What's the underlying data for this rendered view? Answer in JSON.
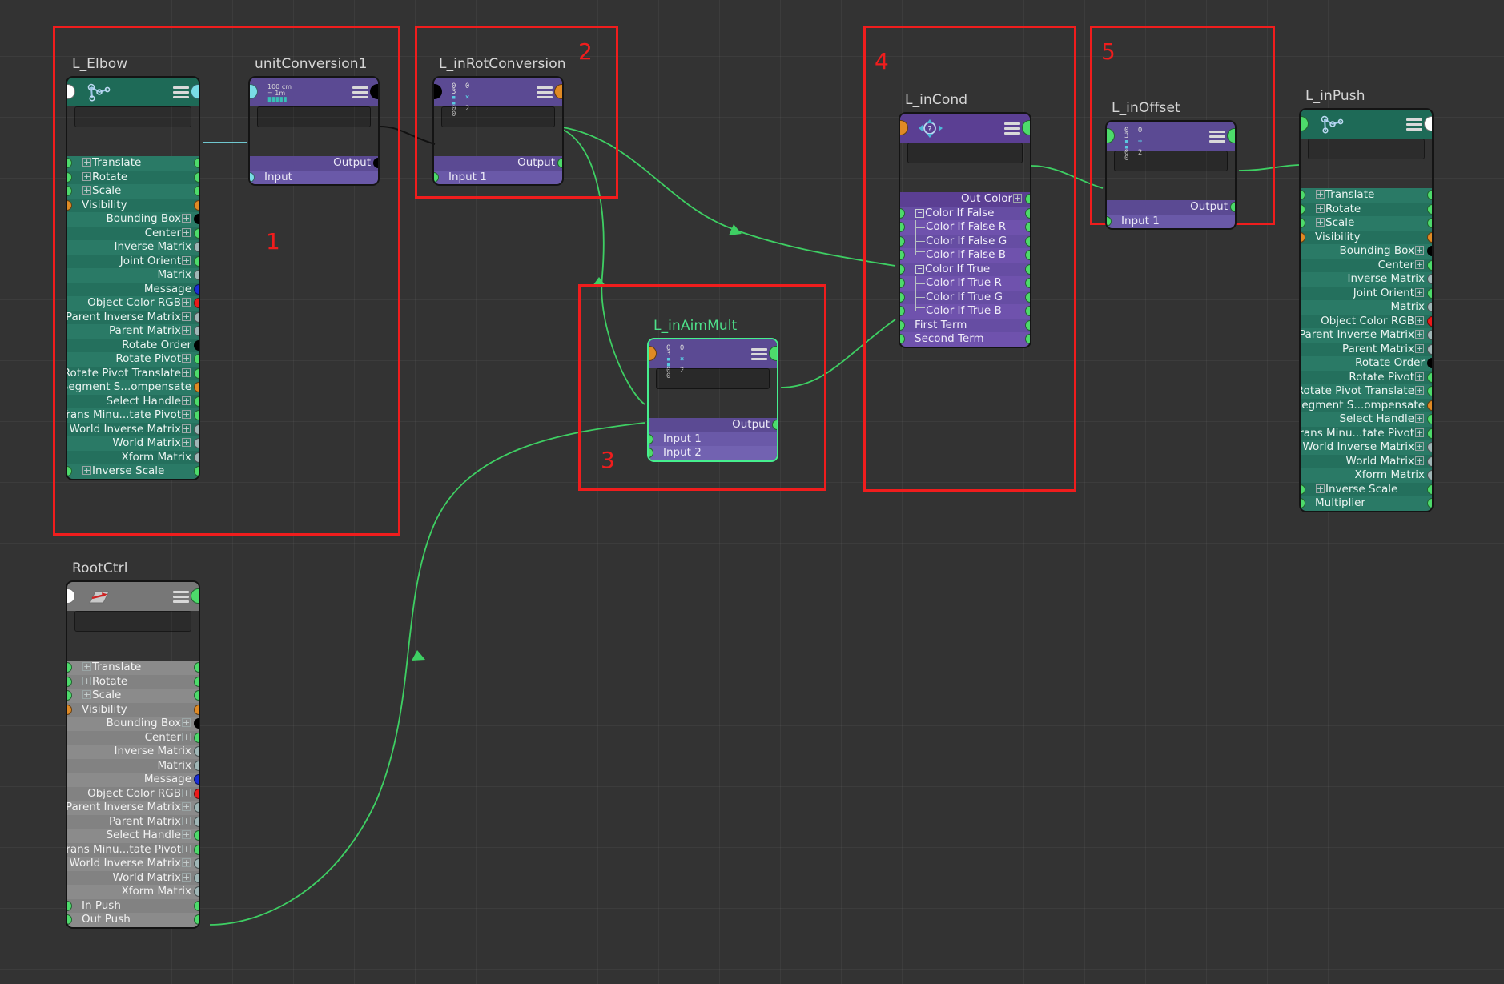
{
  "app": {
    "editor": "Maya Node Editor"
  },
  "annotations": [
    {
      "id": "1",
      "label": "1"
    },
    {
      "id": "2",
      "label": "2"
    },
    {
      "id": "3",
      "label": "3"
    },
    {
      "id": "4",
      "label": "4"
    },
    {
      "id": "5",
      "label": "5"
    }
  ],
  "colors": {
    "joint_header": "#1e6a57",
    "joint_row": "#2a7a66",
    "util_header": "#5b4a93",
    "util_row": "#7262b1",
    "xform_header": "#777777",
    "xform_row": "#8b8b8b",
    "annotation_red": "#f01d1d",
    "wire_green": "#3ecf63",
    "wire_cyan": "#79dde6",
    "selection_green": "#46ef8e",
    "canvas_bg": "#333333"
  },
  "nodes": {
    "l_elbow": {
      "title": "L_Elbow",
      "type": "joint",
      "icon": "joint-icon",
      "menu_icon": "hamburger-icon",
      "rows": [
        {
          "label": "Translate",
          "side": "in",
          "expand": "plus",
          "in": "green",
          "out": "green"
        },
        {
          "label": "Rotate",
          "side": "in",
          "expand": "plus",
          "in": "green",
          "out": "green"
        },
        {
          "label": "Scale",
          "side": "in",
          "expand": "plus",
          "in": "green",
          "out": "green"
        },
        {
          "label": "Visibility",
          "side": "in",
          "expand": "none",
          "in": "orange",
          "out": "orange"
        },
        {
          "label": "Bounding Box",
          "side": "out",
          "expand": "plus",
          "out": "black"
        },
        {
          "label": "Center",
          "side": "out",
          "expand": "plus",
          "out": "green"
        },
        {
          "label": "Inverse Matrix",
          "side": "out",
          "expand": "none",
          "out": "grey"
        },
        {
          "label": "Joint Orient",
          "side": "out",
          "expand": "plus",
          "out": "green"
        },
        {
          "label": "Matrix",
          "side": "out",
          "expand": "none",
          "out": "grey"
        },
        {
          "label": "Message",
          "side": "out",
          "expand": "none",
          "out": "blue"
        },
        {
          "label": "Object Color RGB",
          "side": "out",
          "expand": "plus",
          "out": "red"
        },
        {
          "label": "Parent Inverse Matrix",
          "side": "out",
          "expand": "plus",
          "out": "grey"
        },
        {
          "label": "Parent Matrix",
          "side": "out",
          "expand": "plus",
          "out": "grey"
        },
        {
          "label": "Rotate Order",
          "side": "out",
          "expand": "none",
          "out": "black"
        },
        {
          "label": "Rotate Pivot",
          "side": "out",
          "expand": "plus",
          "out": "green"
        },
        {
          "label": "Rotate Pivot Translate",
          "side": "out",
          "expand": "plus",
          "out": "green"
        },
        {
          "label": "Segment S...ompensate",
          "side": "out",
          "expand": "none",
          "out": "orange"
        },
        {
          "label": "Select Handle",
          "side": "out",
          "expand": "plus",
          "out": "green"
        },
        {
          "label": "Trans Minu...tate Pivot",
          "side": "out",
          "expand": "plus",
          "out": "green"
        },
        {
          "label": "World Inverse Matrix",
          "side": "out",
          "expand": "plus",
          "out": "grey"
        },
        {
          "label": "World Matrix",
          "side": "out",
          "expand": "plus",
          "out": "grey"
        },
        {
          "label": "Xform Matrix",
          "side": "out",
          "expand": "none",
          "out": "grey"
        },
        {
          "label": "Inverse Scale",
          "side": "in",
          "expand": "plus",
          "in": "green",
          "out": "green"
        }
      ],
      "header_in": "white",
      "header_out": "cyan"
    },
    "rootctrl": {
      "title": "RootCtrl",
      "type": "xform",
      "icon": "transform-arrow-icon",
      "menu_icon": "hamburger-icon",
      "header_in": "white",
      "header_out": "green",
      "rows": [
        {
          "label": "Translate",
          "side": "in",
          "expand": "plus",
          "in": "green",
          "out": "green"
        },
        {
          "label": "Rotate",
          "side": "in",
          "expand": "plus",
          "in": "green",
          "out": "green"
        },
        {
          "label": "Scale",
          "side": "in",
          "expand": "plus",
          "in": "green",
          "out": "green"
        },
        {
          "label": "Visibility",
          "side": "in",
          "expand": "none",
          "in": "orange",
          "out": "orange"
        },
        {
          "label": "Bounding Box",
          "side": "out",
          "expand": "plus",
          "out": "black"
        },
        {
          "label": "Center",
          "side": "out",
          "expand": "plus",
          "out": "green"
        },
        {
          "label": "Inverse Matrix",
          "side": "out",
          "expand": "none",
          "out": "grey"
        },
        {
          "label": "Matrix",
          "side": "out",
          "expand": "none",
          "out": "grey"
        },
        {
          "label": "Message",
          "side": "out",
          "expand": "none",
          "out": "blue"
        },
        {
          "label": "Object Color RGB",
          "side": "out",
          "expand": "plus",
          "out": "red"
        },
        {
          "label": "Parent Inverse Matrix",
          "side": "out",
          "expand": "plus",
          "out": "grey"
        },
        {
          "label": "Parent Matrix",
          "side": "out",
          "expand": "plus",
          "out": "grey"
        },
        {
          "label": "Select Handle",
          "side": "out",
          "expand": "plus",
          "out": "green"
        },
        {
          "label": "Trans Minu...tate Pivot",
          "side": "out",
          "expand": "plus",
          "out": "green"
        },
        {
          "label": "World Inverse Matrix",
          "side": "out",
          "expand": "plus",
          "out": "grey"
        },
        {
          "label": "World Matrix",
          "side": "out",
          "expand": "plus",
          "out": "grey"
        },
        {
          "label": "Xform Matrix",
          "side": "out",
          "expand": "none",
          "out": "grey"
        },
        {
          "label": "In Push",
          "side": "in",
          "expand": "none",
          "in": "green",
          "out": "green"
        },
        {
          "label": "Out Push",
          "side": "in",
          "expand": "none",
          "in": "green",
          "out": "green"
        }
      ]
    },
    "l_inpush": {
      "title": "L_inPush",
      "type": "joint",
      "icon": "joint-icon",
      "menu_icon": "hamburger-icon",
      "header_in": "green",
      "header_out": "white",
      "rows": [
        {
          "label": "Translate",
          "side": "in",
          "expand": "plus",
          "in": "green",
          "out": "green"
        },
        {
          "label": "Rotate",
          "side": "in",
          "expand": "plus",
          "in": "green",
          "out": "green"
        },
        {
          "label": "Scale",
          "side": "in",
          "expand": "plus",
          "in": "green",
          "out": "green"
        },
        {
          "label": "Visibility",
          "side": "in",
          "expand": "none",
          "in": "orange",
          "out": "orange"
        },
        {
          "label": "Bounding Box",
          "side": "out",
          "expand": "plus",
          "out": "black"
        },
        {
          "label": "Center",
          "side": "out",
          "expand": "plus",
          "out": "green"
        },
        {
          "label": "Inverse Matrix",
          "side": "out",
          "expand": "none",
          "out": "grey"
        },
        {
          "label": "Joint Orient",
          "side": "out",
          "expand": "plus",
          "out": "green"
        },
        {
          "label": "Matrix",
          "side": "out",
          "expand": "none",
          "out": "grey"
        },
        {
          "label": "Object Color RGB",
          "side": "out",
          "expand": "plus",
          "out": "red"
        },
        {
          "label": "Parent Inverse Matrix",
          "side": "out",
          "expand": "plus",
          "out": "grey"
        },
        {
          "label": "Parent Matrix",
          "side": "out",
          "expand": "plus",
          "out": "grey"
        },
        {
          "label": "Rotate Order",
          "side": "out",
          "expand": "none",
          "out": "black"
        },
        {
          "label": "Rotate Pivot",
          "side": "out",
          "expand": "plus",
          "out": "green"
        },
        {
          "label": "Rotate Pivot Translate",
          "side": "out",
          "expand": "plus",
          "out": "green"
        },
        {
          "label": "Segment S...ompensate",
          "side": "out",
          "expand": "none",
          "out": "orange"
        },
        {
          "label": "Select Handle",
          "side": "out",
          "expand": "plus",
          "out": "green"
        },
        {
          "label": "Trans Minu...tate Pivot",
          "side": "out",
          "expand": "plus",
          "out": "green"
        },
        {
          "label": "World Inverse Matrix",
          "side": "out",
          "expand": "plus",
          "out": "grey"
        },
        {
          "label": "World Matrix",
          "side": "out",
          "expand": "plus",
          "out": "grey"
        },
        {
          "label": "Xform Matrix",
          "side": "out",
          "expand": "none",
          "out": "grey"
        },
        {
          "label": "Inverse Scale",
          "side": "in",
          "expand": "plus",
          "in": "green",
          "out": "green"
        },
        {
          "label": "Multiplier",
          "side": "in",
          "expand": "none",
          "in": "green",
          "out": "green"
        }
      ]
    },
    "unitconversion1": {
      "title": "unitConversion1",
      "type": "util",
      "icon": "unit-conversion-icon",
      "icon_text_top": "100 cm",
      "icon_text_bot": "= 1m",
      "menu_icon": "hamburger-icon",
      "header_in": "cyan",
      "header_out": "black",
      "rows": [
        {
          "label": "Output",
          "side": "out",
          "expand": "none",
          "out": "black",
          "header_row": true
        },
        {
          "label": "Input",
          "side": "in",
          "expand": "none",
          "in": "cyan"
        }
      ]
    },
    "l_inrotconversion": {
      "title": "L_inRotConversion",
      "type": "util",
      "icon": "multiply-divide-icon",
      "icon_glyph": "×",
      "menu_icon": "hamburger-icon",
      "header_in": "black",
      "header_out": "orange",
      "rows": [
        {
          "label": "Output",
          "side": "out",
          "expand": "none",
          "out": "green",
          "header_row": true
        },
        {
          "label": "Input 1",
          "side": "in",
          "expand": "none",
          "in": "green"
        }
      ]
    },
    "l_inaimmult": {
      "title": "L_inAimMult",
      "type": "util",
      "selected": true,
      "icon": "multiply-divide-icon",
      "icon_glyph": "×",
      "menu_icon": "hamburger-icon",
      "header_in": "orange",
      "header_out": "green",
      "rows": [
        {
          "label": "Output",
          "side": "out",
          "expand": "none",
          "out": "green",
          "header_row": true
        },
        {
          "label": "Input 1",
          "side": "in",
          "expand": "none",
          "in": "green"
        },
        {
          "label": "Input 2",
          "side": "in",
          "expand": "none",
          "in": "green"
        }
      ]
    },
    "l_incond": {
      "title": "L_inCond",
      "type": "cond",
      "icon": "condition-icon",
      "menu_icon": "hamburger-icon",
      "header_in": "orange",
      "header_out": "green",
      "rows": [
        {
          "label": "Out Color",
          "side": "out",
          "expand": "plus",
          "out": "green",
          "header_row": true
        },
        {
          "label": "Color If False",
          "side": "in",
          "expand": "minus",
          "in": "green",
          "out": "green"
        },
        {
          "label": "Color If False R",
          "side": "sub",
          "expand": "none",
          "in": "green",
          "out": "green",
          "tree": "mid"
        },
        {
          "label": "Color If False G",
          "side": "sub",
          "expand": "none",
          "in": "green",
          "out": "green",
          "tree": "mid"
        },
        {
          "label": "Color If False B",
          "side": "sub",
          "expand": "none",
          "in": "green",
          "out": "green",
          "tree": "last"
        },
        {
          "label": "Color If True",
          "side": "in",
          "expand": "minus",
          "in": "green",
          "out": "green"
        },
        {
          "label": "Color If True R",
          "side": "sub",
          "expand": "none",
          "in": "green",
          "out": "green",
          "tree": "mid"
        },
        {
          "label": "Color If True G",
          "side": "sub",
          "expand": "none",
          "in": "green",
          "out": "green",
          "tree": "mid"
        },
        {
          "label": "Color If True B",
          "side": "sub",
          "expand": "none",
          "in": "green",
          "out": "green",
          "tree": "last"
        },
        {
          "label": "First Term",
          "side": "in",
          "expand": "none",
          "in": "green",
          "out": "green"
        },
        {
          "label": "Second Term",
          "side": "in",
          "expand": "none",
          "in": "green",
          "out": "green"
        }
      ]
    },
    "l_inoffset": {
      "title": "L_inOffset",
      "type": "util",
      "icon": "plus-minus-average-icon",
      "icon_glyph": "+",
      "menu_icon": "hamburger-icon",
      "header_in": "green",
      "header_out": "green",
      "rows": [
        {
          "label": "Output",
          "side": "out",
          "expand": "none",
          "out": "green",
          "header_row": true
        },
        {
          "label": "Input 1",
          "side": "in",
          "expand": "none",
          "in": "green"
        }
      ]
    }
  }
}
